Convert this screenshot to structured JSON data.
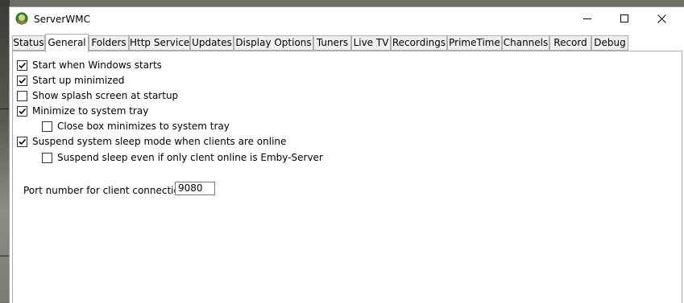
{
  "window": {
    "title": "ServerWMC",
    "icon": "serverwmc-app-icon"
  },
  "titlebar_buttons": [
    "minimize",
    "maximize",
    "close"
  ],
  "tabs": [
    {
      "label": "Status",
      "active": false
    },
    {
      "label": "General",
      "active": true
    },
    {
      "label": "Folders",
      "active": false
    },
    {
      "label": "Http Service",
      "active": false
    },
    {
      "label": "Updates",
      "active": false
    },
    {
      "label": "Display Options",
      "active": false
    },
    {
      "label": "Tuners",
      "active": false
    },
    {
      "label": "Live TV",
      "active": false
    },
    {
      "label": "Recordings",
      "active": false
    },
    {
      "label": "PrimeTime",
      "active": false
    },
    {
      "label": "Channels",
      "active": false
    },
    {
      "label": "Record",
      "active": false
    },
    {
      "label": "Debug",
      "active": false
    }
  ],
  "general": {
    "options": [
      {
        "label": "Start when Windows starts",
        "checked": true
      },
      {
        "label": "Start up minimized",
        "checked": true
      },
      {
        "label": "Show splash screen at startup",
        "checked": false
      },
      {
        "label": "Minimize to system tray",
        "checked": true
      },
      {
        "label": "Close box minimizes to system tray",
        "checked": false
      },
      {
        "label": "Suspend system sleep mode when clients are online",
        "checked": true
      },
      {
        "label": "Suspend sleep even if only clent online is Emby-Server",
        "checked": false
      }
    ],
    "port_label": "Port number for client connection:",
    "port_value": "9080"
  }
}
